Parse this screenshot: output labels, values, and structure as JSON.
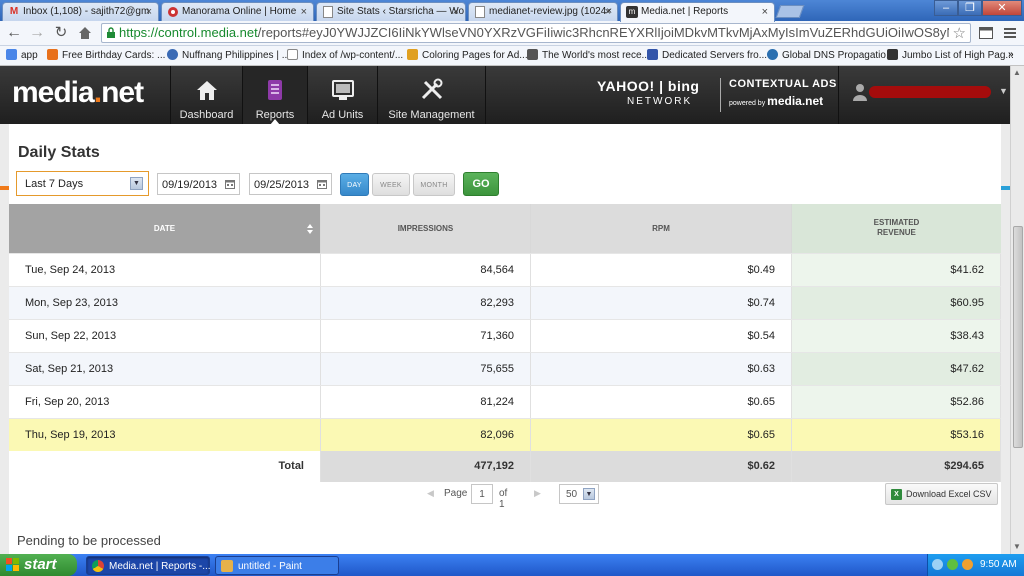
{
  "browser": {
    "tabs": [
      {
        "title": "Inbox (1,108) - sajith72@gm",
        "icon": "gmail-icon",
        "active": false
      },
      {
        "title": "Manorama Online | Home",
        "icon": "manorama-icon",
        "active": false
      },
      {
        "title": "Site Stats ‹ Starsricha — Wo",
        "icon": "page-icon",
        "active": false
      },
      {
        "title": "medianet-review.jpg (1024×",
        "icon": "page-icon",
        "active": false
      },
      {
        "title": "Media.net | Reports",
        "icon": "medianet-icon",
        "active": true
      }
    ],
    "url_domain": "https://control.media.net",
    "url_rest": "/reports#eyJ0YWJJZCI6IiNkYWlseVN0YXRzVGFiIiwic3RhcnREYXRlIjoiMDkvMTkvMjAxMyIsImVuZERhdGUiOiIwOS8yNS8",
    "bookmarks": [
      {
        "label": "app",
        "color": "#4a86e8"
      },
      {
        "label": "Free Birthday Cards: ...",
        "color": "#e8711c"
      },
      {
        "label": "Nuffnang Philippines | ...",
        "color": "#3b6bb5"
      },
      {
        "label": "Index of /wp-content/...",
        "color": "#ffffff"
      },
      {
        "label": "Coloring Pages for Ad...",
        "color": "#e0a020"
      },
      {
        "label": "The World's most rece...",
        "color": "#555555"
      },
      {
        "label": "Dedicated Servers fro...",
        "color": "#3355aa"
      },
      {
        "label": "Global DNS Propagatio...",
        "color": "#2a6fb0"
      },
      {
        "label": "Jumbo List of High Pag...",
        "color": "#333333"
      }
    ]
  },
  "site": {
    "logo_main": "media",
    "logo_dot": ".",
    "logo_tail": "net",
    "nav": [
      {
        "label": "Dashboard",
        "icon": "home-icon"
      },
      {
        "label": "Reports",
        "icon": "reports-icon"
      },
      {
        "label": "Ad Units",
        "icon": "ad-units-icon"
      },
      {
        "label": "Site Management",
        "icon": "tools-icon"
      }
    ],
    "partner_brand": "YAHOO! | bing",
    "partner_network": "NETWORK",
    "contextual_title": "CONTEXTUAL ADS",
    "contextual_powered": "powered by",
    "contextual_brand": "media.net"
  },
  "report": {
    "title": "Daily Stats",
    "range": "Last 7 Days",
    "start_date": "09/19/2013",
    "end_date": "09/25/2013",
    "period_buttons": [
      "DAY",
      "WEEK",
      "MONTH"
    ],
    "go_label": "GO",
    "columns": [
      "DATE",
      "IMPRESSIONS",
      "RPM",
      "ESTIMATED",
      "REVENUE"
    ],
    "rows": [
      {
        "date": "Tue, Sep 24, 2013",
        "impressions": "84,564",
        "rpm": "$0.49",
        "revenue": "$41.62"
      },
      {
        "date": "Mon, Sep 23, 2013",
        "impressions": "82,293",
        "rpm": "$0.74",
        "revenue": "$60.95"
      },
      {
        "date": "Sun, Sep 22, 2013",
        "impressions": "71,360",
        "rpm": "$0.54",
        "revenue": "$38.43"
      },
      {
        "date": "Sat, Sep 21, 2013",
        "impressions": "75,655",
        "rpm": "$0.63",
        "revenue": "$47.62"
      },
      {
        "date": "Fri, Sep 20, 2013",
        "impressions": "81,224",
        "rpm": "$0.65",
        "revenue": "$52.86"
      },
      {
        "date": "Thu, Sep 19, 2013",
        "impressions": "82,096",
        "rpm": "$0.65",
        "revenue": "$53.16"
      }
    ],
    "total_label": "Total",
    "total": {
      "impressions": "477,192",
      "rpm": "$0.62",
      "revenue": "$294.65"
    },
    "pager": {
      "page_label": "Page",
      "page": "1",
      "of_label": "of 1",
      "per_page": "50"
    },
    "excel_label": "Download Excel CSV",
    "pending_label": "Pending to be processed"
  },
  "taskbar": {
    "start_label": "start",
    "tasks": [
      {
        "label": "Media.net | Reports -...",
        "active": true
      },
      {
        "label": "untitled - Paint",
        "active": false
      }
    ],
    "clock": "9:50 AM"
  },
  "colors": {
    "accent_orange": "#f07a1a",
    "day_button": "#3688ca",
    "go_button": "#3c943c",
    "highlight_row": "#fbf9b4",
    "revenue_column": "#edf5ec"
  }
}
